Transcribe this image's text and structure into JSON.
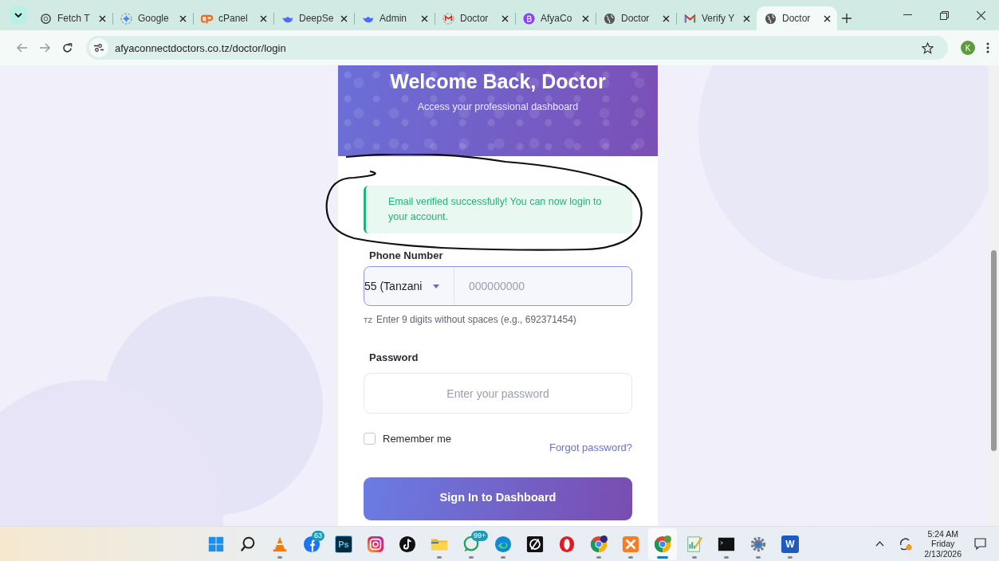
{
  "browser": {
    "tabs": [
      {
        "title": "Fetch T",
        "selected": false
      },
      {
        "title": "Google",
        "selected": false
      },
      {
        "title": "cPanel",
        "selected": false
      },
      {
        "title": "DeepSe",
        "selected": false
      },
      {
        "title": "Admin",
        "selected": false
      },
      {
        "title": "Doctor",
        "selected": false
      },
      {
        "title": "AfyaCo",
        "selected": false
      },
      {
        "title": "Doctor",
        "selected": false
      },
      {
        "title": "Verify Y",
        "selected": false
      },
      {
        "title": "Doctor",
        "selected": true
      }
    ],
    "url": "afyaconnectdoctors.co.tz/doctor/login",
    "profile_initial": "K"
  },
  "header": {
    "title": "Welcome Back, Doctor",
    "subtitle": "Access your professional dashboard"
  },
  "alert": {
    "text": "Email verified successfully! You can now login to your account."
  },
  "phone": {
    "label": "Phone Number",
    "country_value": "55 (Tanzani",
    "placeholder": "000000000",
    "hint_prefix": "TZ",
    "hint": "Enter 9 digits without spaces (e.g., 692371454)"
  },
  "password": {
    "label": "Password",
    "placeholder": "Enter your password"
  },
  "remember": {
    "label": "Remember me",
    "checked": false
  },
  "forgot_link": "Forgot password?",
  "submit_button": "Sign In to Dashboard",
  "taskbar": {
    "apps": [
      {
        "kind": "windows",
        "running": false,
        "selected": false
      },
      {
        "kind": "search",
        "running": false,
        "selected": false
      },
      {
        "kind": "cone",
        "running": true,
        "selected": false
      },
      {
        "kind": "facebook",
        "running": false,
        "selected": false,
        "badge": "63"
      },
      {
        "kind": "letters",
        "label": "Ps",
        "running": false,
        "selected": false
      },
      {
        "kind": "camera",
        "running": false,
        "selected": false
      },
      {
        "kind": "tiktok",
        "running": false,
        "selected": false
      },
      {
        "kind": "folder",
        "running": true,
        "selected": false
      },
      {
        "kind": "whatsapp",
        "running": true,
        "selected": false,
        "badge": "99+"
      },
      {
        "kind": "edge",
        "running": true,
        "selected": false
      },
      {
        "kind": "slash",
        "running": false,
        "selected": false
      },
      {
        "kind": "opera",
        "running": false,
        "selected": false
      },
      {
        "kind": "chrome",
        "running": true,
        "selected": false
      },
      {
        "kind": "xampp",
        "running": true,
        "selected": false
      },
      {
        "kind": "chrome",
        "running": true,
        "selected": true
      },
      {
        "kind": "notepad",
        "running": true,
        "selected": false
      },
      {
        "kind": "terminal",
        "running": true,
        "selected": false
      },
      {
        "kind": "settings",
        "running": true,
        "selected": false
      },
      {
        "kind": "letters",
        "label": "W",
        "running": true,
        "selected": false
      }
    ],
    "time": "5:24 AM",
    "day": "Friday",
    "date": "2/13/2026"
  }
}
